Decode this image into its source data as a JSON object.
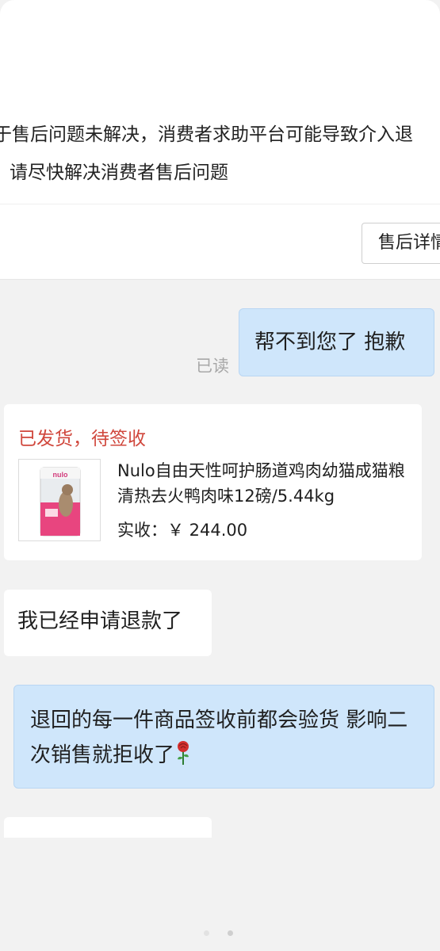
{
  "notice": {
    "line1": "于售后问题未解决，消费者求助平台可能导致介入退",
    "line2": "请尽快解决消费者售后问题",
    "detail_button": "售后详情"
  },
  "messages": [
    {
      "text": "帮不到您了 抱歉",
      "side": "right"
    },
    {
      "text": "我已经申请退款了",
      "side": "left"
    },
    {
      "text": "退回的每一件商品签收前都会验货 影响二次销售就拒收了",
      "side": "right",
      "emoji": "rose-icon"
    },
    {
      "text": "",
      "side": "left"
    }
  ],
  "read_status": "已读",
  "order": {
    "status": "已发货，待签收",
    "title": "Nulo自由天性呵护肠道鸡肉幼猫成猫粮清热去火鸭肉味12磅/5.44kg",
    "price": "实收：￥ 244.00",
    "image_icon": "cat-food-bag-icon"
  },
  "colors": {
    "accent_red": "#d0473c",
    "bubble_blue": "#cfe6fb",
    "background": "#f2f2f2"
  }
}
